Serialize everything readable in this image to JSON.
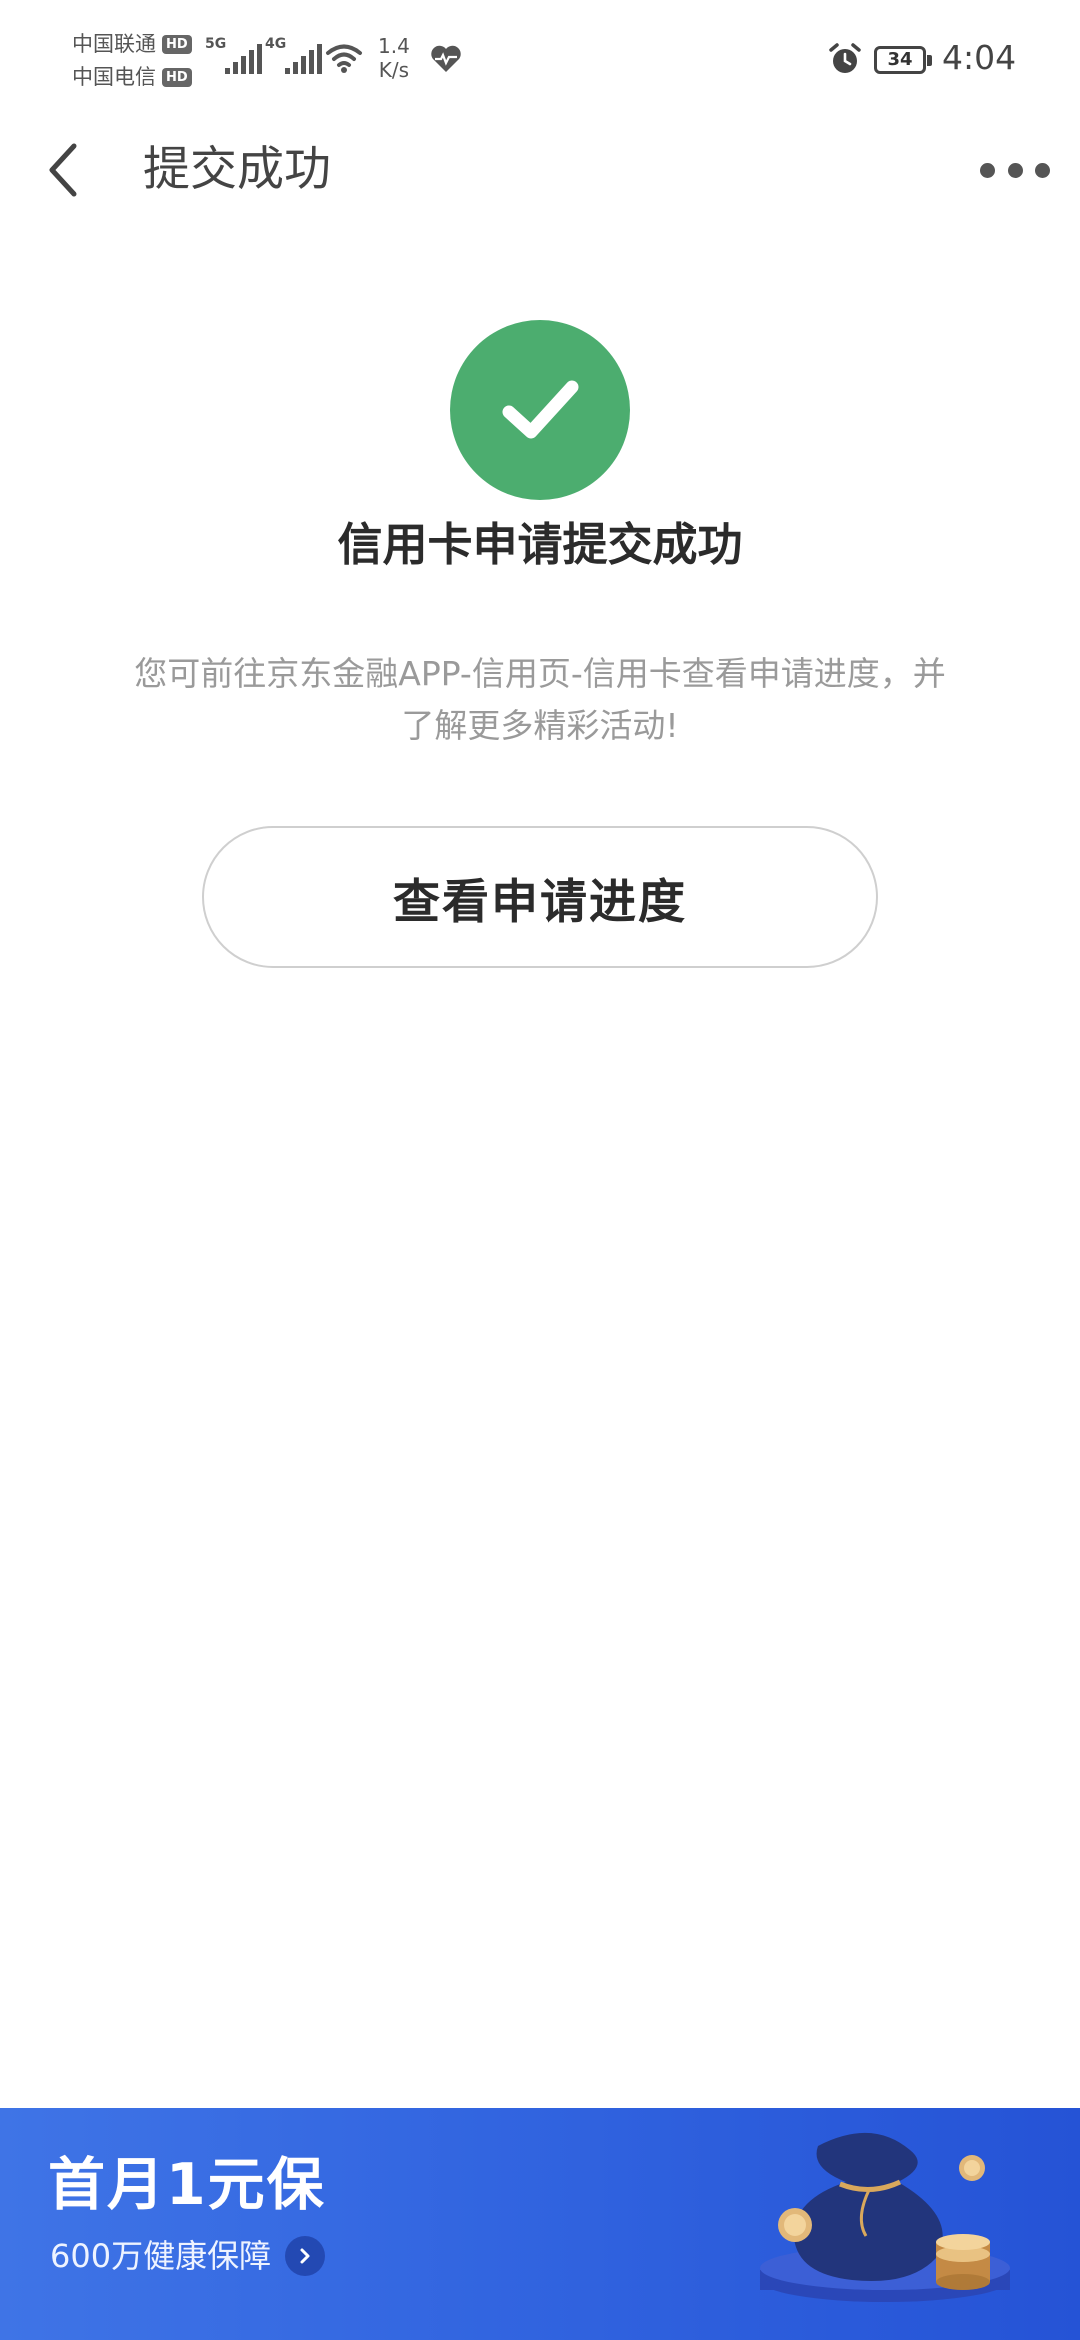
{
  "status_bar": {
    "carrier_1": "中国联通",
    "carrier_2": "中国电信",
    "hd_badge": "HD",
    "signal_1_label": "5G",
    "signal_2_label": "4G",
    "net_speed_value": "1.4",
    "net_speed_unit": "K/s",
    "battery_level": "34",
    "time": "4:04"
  },
  "nav": {
    "title": "提交成功"
  },
  "result": {
    "title": "信用卡申请提交成功",
    "description_line1": "您可前往京东金融APP-信用页-信用卡查看申请进度，并",
    "description_line2": "了解更多精彩活动!",
    "button_label": "查看申请进度",
    "success_color": "#4cad6f"
  },
  "banner": {
    "title": "首月1元保",
    "subtitle": "600万健康保障",
    "background_color": "#3265e0"
  }
}
